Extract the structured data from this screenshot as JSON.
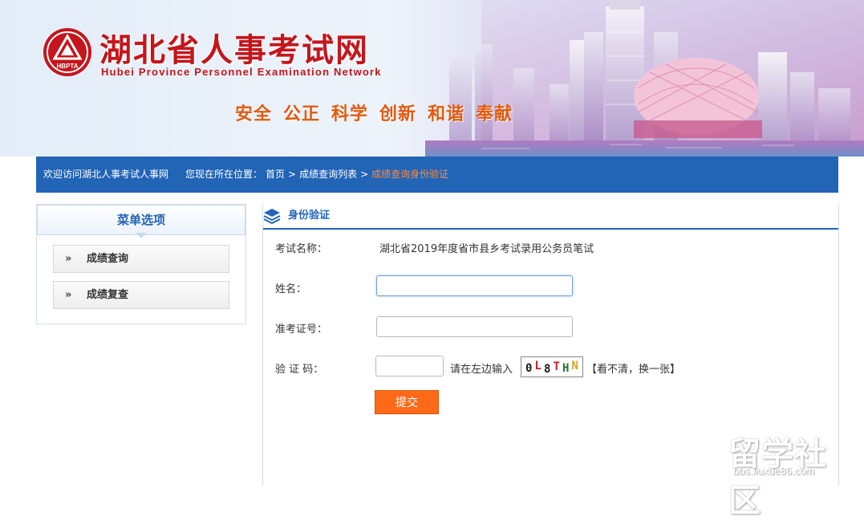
{
  "header": {
    "title": "湖北省人事考试网",
    "subtitle": "Hubei Province Personnel Examination Network",
    "logo_text": "HBPTA",
    "slogan": [
      "安全",
      "公正",
      "科学",
      "创新",
      "和谐",
      "奉献"
    ]
  },
  "navbar": {
    "welcome": "欢迎访问湖北人事考试人事网",
    "location_label": "您现在所在位置：",
    "breadcrumb": [
      "首页",
      "成绩查询列表",
      "成绩查询身份验证"
    ],
    "separator": ">"
  },
  "sidebar": {
    "title": "菜单选项",
    "items": [
      {
        "label": "成绩查询"
      },
      {
        "label": "成绩复查"
      }
    ]
  },
  "main": {
    "panel_title": "身份验证",
    "exam_name_label": "考试名称：",
    "exam_name_value": "湖北省2019年度省市县乡考试录用公务员笔试",
    "name_label": "姓名：",
    "name_value": "",
    "ticket_label": "准考证号：",
    "ticket_value": "",
    "captcha_label": "验 证 码：",
    "captcha_value": "",
    "captcha_hint": "请在左边输入",
    "captcha_chars": [
      {
        "ch": "0",
        "color": "#1a1a1a"
      },
      {
        "ch": "L",
        "color": "#c21f1f"
      },
      {
        "ch": "8",
        "color": "#1a1a1a"
      },
      {
        "ch": "T",
        "color": "#c21f1f"
      },
      {
        "ch": "H",
        "color": "#1d7a2e"
      },
      {
        "ch": "N",
        "color": "#d6a21e"
      }
    ],
    "captcha_refresh": "【看不清，换一张】",
    "submit_label": "提交"
  },
  "watermark": {
    "title": "留学社区",
    "url": "bbs.liuxue86.com"
  },
  "colors": {
    "primary_blue": "#2264b6",
    "title_red": "#c4161c",
    "slogan_orange": "#e25a10",
    "submit_orange": "#ff6a1a",
    "breadcrumb_current": "#ff8a3c"
  }
}
